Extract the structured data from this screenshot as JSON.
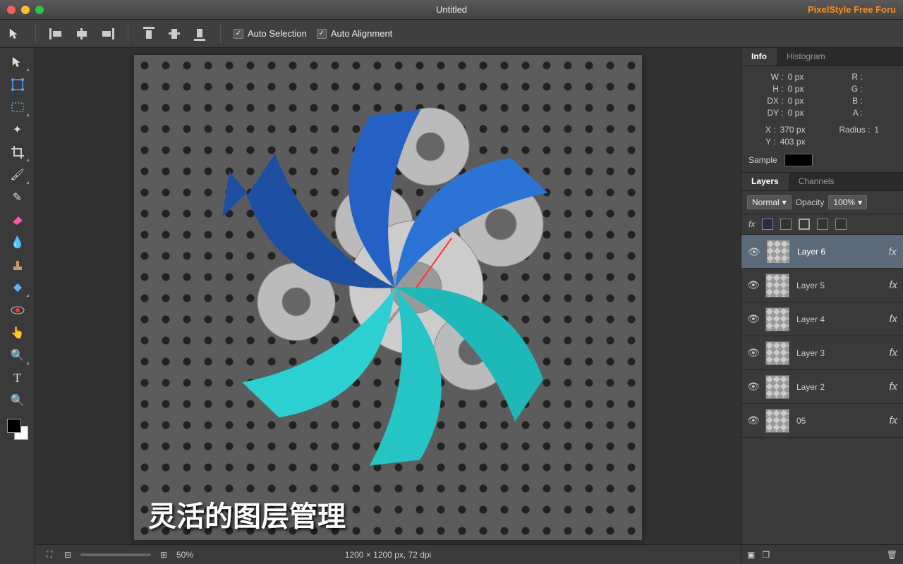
{
  "window": {
    "title": "Untitled",
    "forum_link": "PixelStyle Free Foru"
  },
  "options": {
    "auto_selection": "Auto Selection",
    "auto_alignment": "Auto Alignment"
  },
  "info_panel": {
    "tab_info": "Info",
    "tab_histogram": "Histogram",
    "w_label": "W :",
    "w_val": "0 px",
    "h_label": "H :",
    "h_val": "0 px",
    "dx_label": "DX :",
    "dx_val": "0 px",
    "dy_label": "DY :",
    "dy_val": "0 px",
    "r_label": "R :",
    "g_label": "G :",
    "b_label": "B :",
    "a_label": "A :",
    "x_label": "X :",
    "x_val": "370 px",
    "y_label": "Y :",
    "y_val": "403 px",
    "radius_label": "Radius :",
    "radius_val": "1",
    "sample_label": "Sample"
  },
  "layers_panel": {
    "tab_layers": "Layers",
    "tab_channels": "Channels",
    "blend_mode": "Normal",
    "opacity_label": "Opacity",
    "opacity_val": "100%",
    "fx_label": "fx",
    "layers": [
      {
        "name": "Layer 6",
        "selected": true,
        "fx": true
      },
      {
        "name": "Layer 5",
        "selected": false,
        "fx": true
      },
      {
        "name": "Layer 4",
        "selected": false,
        "fx": true
      },
      {
        "name": "Layer 3",
        "selected": false,
        "fx": true
      },
      {
        "name": "Layer 2",
        "selected": false,
        "fx": true
      },
      {
        "name": "05",
        "selected": false,
        "fx": true
      }
    ]
  },
  "status": {
    "zoom": "50%",
    "doc_info": "1200 × 1200 px, 72 dpi"
  },
  "canvas": {
    "caption": "灵活的图层管理"
  }
}
